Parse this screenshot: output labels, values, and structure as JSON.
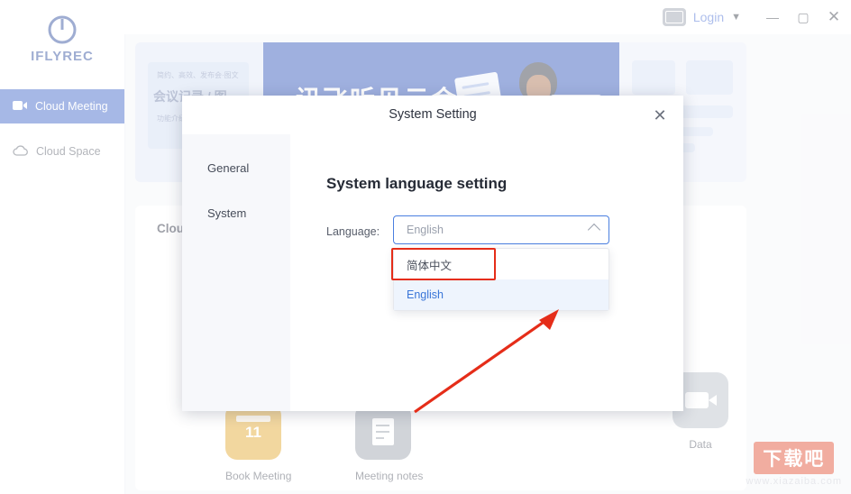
{
  "app": {
    "brand": "IFLYREC",
    "sidebar": {
      "items": [
        {
          "label": "Cloud Meeting",
          "icon": "video-camera-icon",
          "active": true
        },
        {
          "label": "Cloud Space",
          "icon": "cloud-icon",
          "active": false
        }
      ]
    },
    "titlebar": {
      "login_label": "Login",
      "caret": "▼",
      "minimize": "—",
      "maximize": "▢",
      "close": "✕"
    },
    "banner": {
      "title": "讯飞听见云会议",
      "left_small_text": "简约、高效、发布会·图文",
      "left_big_text": "会议记录 / 图",
      "left_small_text2": "功能介绍"
    },
    "content": {
      "card_title": "Cloud Meeting",
      "tiles": [
        {
          "label": "Book Meeting",
          "icon": "calendar-icon",
          "day": "11"
        },
        {
          "label": "Meeting notes",
          "icon": "note-icon"
        },
        {
          "label": "Data",
          "icon": "camera-icon"
        }
      ]
    },
    "watermark": {
      "box": "下载吧",
      "sub": "www.xiazaiba.com"
    }
  },
  "modal": {
    "title": "System Setting",
    "close_icon": "close-icon",
    "nav": [
      {
        "label": "General",
        "active": true
      },
      {
        "label": "System",
        "active": false
      }
    ],
    "section_title": "System language setting",
    "language": {
      "label": "Language:",
      "selected": "English",
      "placeholder": "English",
      "arrow_icon": "chevron-up-icon",
      "options": [
        {
          "label": "简体中文",
          "highlighted": false
        },
        {
          "label": "English",
          "highlighted": true
        }
      ]
    }
  },
  "annotations": {
    "highlight_color": "#e52d19",
    "arrow_color": "#e52d19"
  }
}
